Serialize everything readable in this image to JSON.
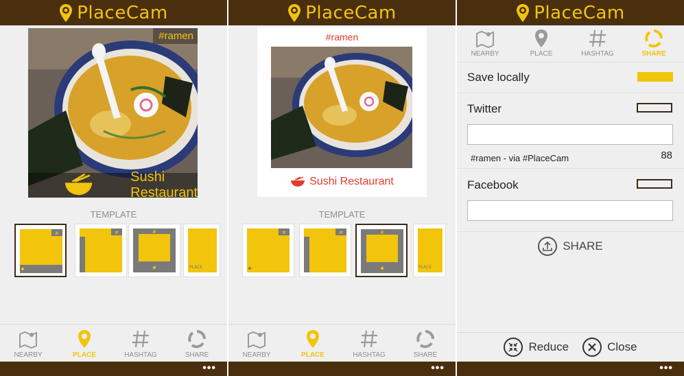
{
  "app": {
    "name": "PlaceCam",
    "more_glyph": "•••"
  },
  "photo": {
    "hashtag": "#ramen",
    "place": "Sushi Restaurant",
    "subject": "ramen bowl"
  },
  "screen1": {
    "template_label": "TEMPLATE",
    "selected_template": 1
  },
  "screen2": {
    "template_label": "TEMPLATE",
    "selected_template": 3
  },
  "nav": {
    "items": [
      {
        "label": "NEARBY",
        "icon": "map-icon"
      },
      {
        "label": "PLACE",
        "icon": "location-pin-icon"
      },
      {
        "label": "HASHTAG",
        "icon": "hashtag-icon"
      },
      {
        "label": "SHARE",
        "icon": "share-cycle-icon"
      }
    ],
    "active_screen1": "PLACE",
    "active_screen2": "PLACE",
    "active_screen3": "SHARE"
  },
  "share": {
    "save_locally": {
      "label": "Save locally",
      "on": true
    },
    "twitter": {
      "label": "Twitter",
      "on": false,
      "input_value": "",
      "caption": "#ramen - via #PlaceCam",
      "remaining": "88"
    },
    "facebook": {
      "label": "Facebook",
      "on": false,
      "input_value": ""
    },
    "share_button": "SHARE",
    "reduce_button": "Reduce",
    "close_button": "Close"
  },
  "colors": {
    "brand_brown": "#4a2f0e",
    "brand_yellow": "#f2c40c",
    "accent_red": "#e23b2e",
    "template_gray": "#7a7a7a"
  }
}
